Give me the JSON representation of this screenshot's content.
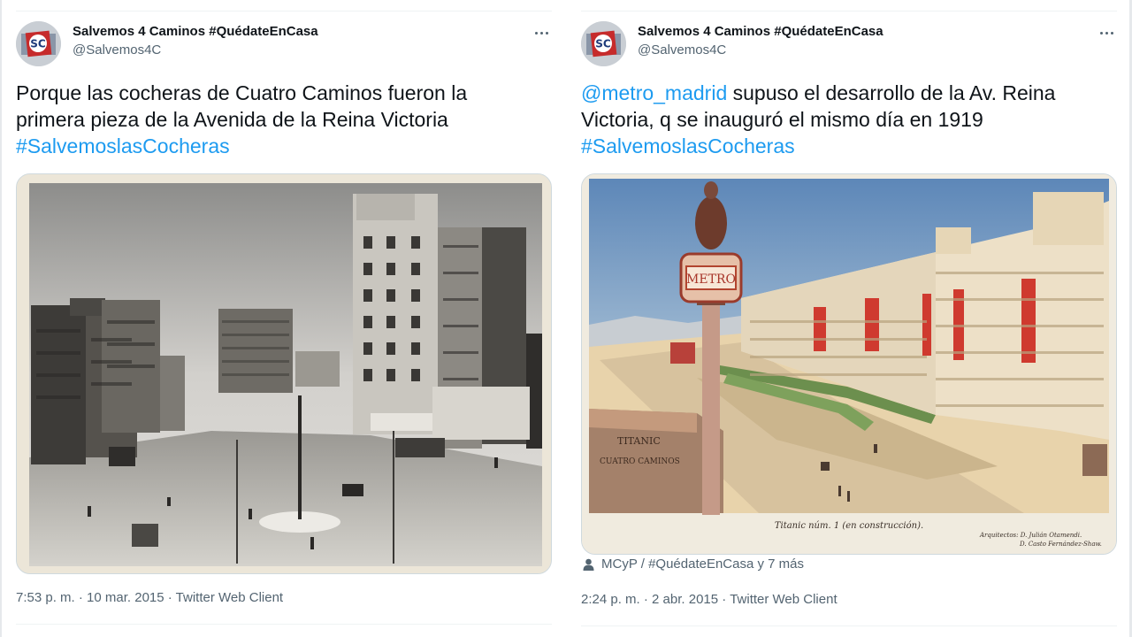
{
  "colors": {
    "link": "#1d9bf0",
    "text": "#0f1419",
    "secondary": "#536471",
    "border": "#cfd9de"
  },
  "tweets": [
    {
      "author": {
        "display_name": "Salvemos 4 Caminos #QuédateEnCasa",
        "handle": "@Salvemos4C",
        "avatar_icon": "avatar-logo-icon"
      },
      "more_icon": "more-dots-icon",
      "text_line1": "Porque las cocheras de Cuatro Caminos fueron la",
      "text_line2": "primera pieza de la Avenida de la Reina Victoria",
      "hashtag": "#SalvemoslasCocheras",
      "media": {
        "type": "historic-photo"
      },
      "time": "7:53 p. m.",
      "separator": " · ",
      "date": "10 mar. 2015",
      "client": "Twitter Web Client"
    },
    {
      "author": {
        "display_name": "Salvemos 4 Caminos #QuédateEnCasa",
        "handle": "@Salvemos4C",
        "avatar_icon": "avatar-logo-icon"
      },
      "more_icon": "more-dots-icon",
      "mention": "@metro_madrid",
      "text_line1_rest": " supuso el desarrollo de la Av. Reina",
      "text_line2": "Victoria, q se inauguró el mismo día en 1919",
      "hashtag": "#SalvemoslasCocheras",
      "media": {
        "type": "illustration",
        "sign_text": "METRO",
        "wall_text_1": "TITANIC",
        "wall_text_2": "CUATRO CAMINOS",
        "caption": "Titanic núm. 1 (en construcción).",
        "credit_line1": "Arquitectos: D. Julián Otamendi.",
        "credit_line2": "D. Casto Fernández-Shaw."
      },
      "via": {
        "icon": "person-icon",
        "text": "MCyP / #QuédateEnCasa y 7 más"
      },
      "time": "2:24 p. m.",
      "separator": " · ",
      "date": "2 abr. 2015",
      "client": "Twitter Web Client"
    }
  ]
}
